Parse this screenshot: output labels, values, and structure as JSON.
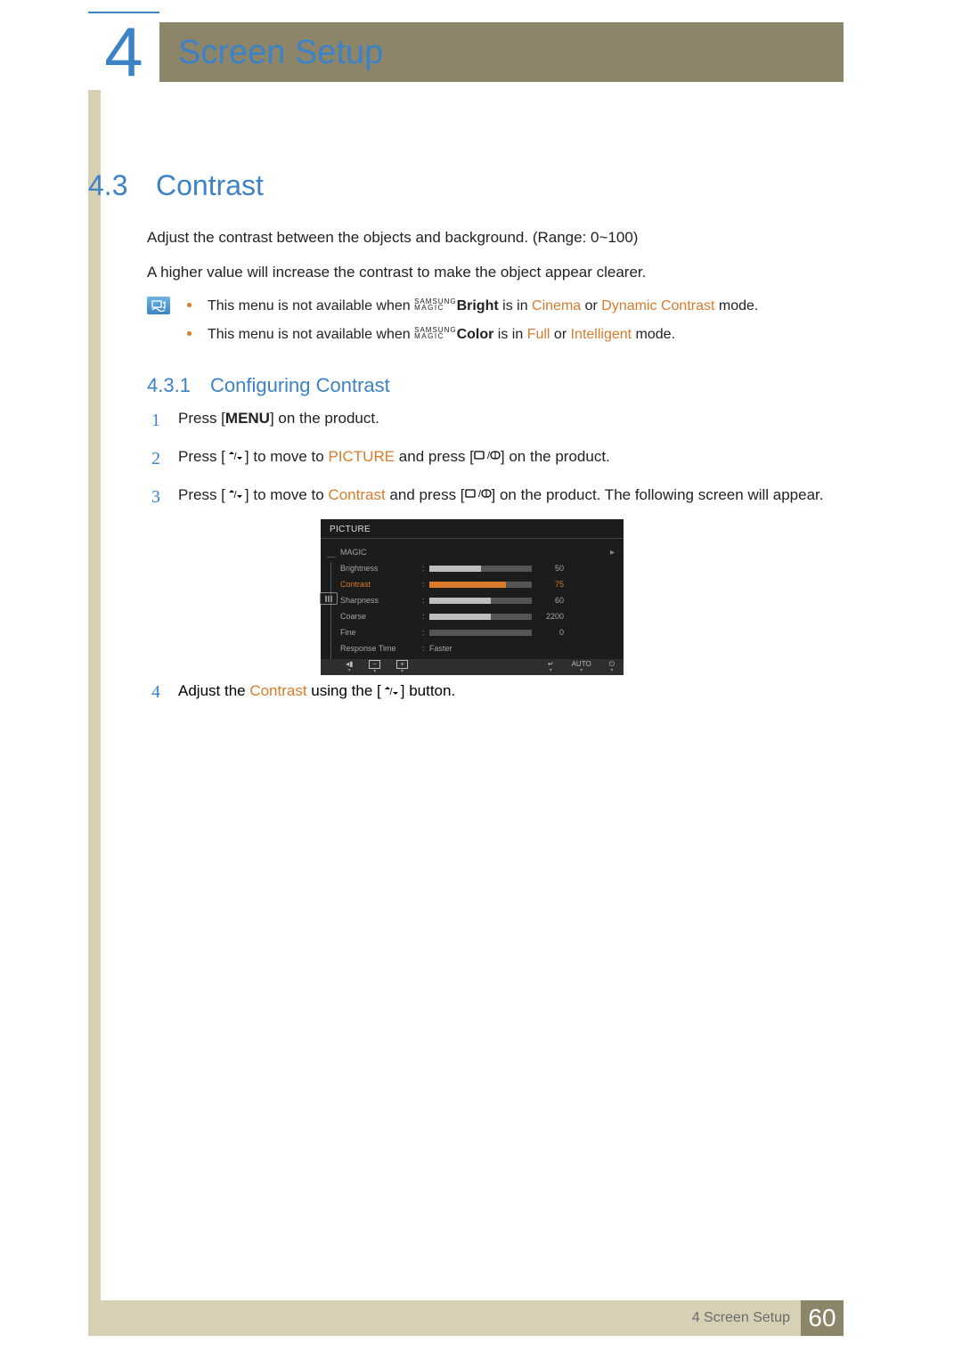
{
  "chapter": {
    "number": "4",
    "title": "Screen Setup"
  },
  "section": {
    "number": "4.3",
    "title": "Contrast"
  },
  "intro": {
    "p1": "Adjust the contrast between the objects and background. (Range: 0~100)",
    "p2": "A higher value will increase the contrast to make the object appear clearer."
  },
  "notes": {
    "n1_pre": "This menu is not available when ",
    "magic_top": "SAMSUNG",
    "magic_bot": "MAGIC",
    "n1_label": "Bright",
    "n1_mid": " is in ",
    "n1_hl1": "Cinema",
    "n1_or": " or ",
    "n1_hl2": "Dynamic Contrast",
    "n1_end": " mode.",
    "n2_pre": "This menu is not available when ",
    "n2_label": "Color",
    "n2_mid": " is in ",
    "n2_hl1": "Full",
    "n2_or": " or ",
    "n2_hl2": "Intelligent",
    "n2_end": " mode."
  },
  "subsection": {
    "number": "4.3.1",
    "title": "Configuring Contrast"
  },
  "steps": {
    "s1_num": "1",
    "s1_a": "Press [",
    "s1_menu": "MENU",
    "s1_b": "] on the product.",
    "s2_num": "2",
    "s2_a": "Press [",
    "s2_b": "] to move to ",
    "s2_pic": "PICTURE",
    "s2_c": " and press [",
    "s2_d": "] on the product.",
    "s3_num": "3",
    "s3_a": "Press [",
    "s3_b": "] to move to ",
    "s3_con": "Contrast",
    "s3_c": " and press [",
    "s3_d": "] on the product. The following screen will appear.",
    "s4_num": "4",
    "s4_a": "Adjust the ",
    "s4_con": "Contrast",
    "s4_b": " using the [",
    "s4_c": "] button."
  },
  "osd": {
    "title": "PICTURE",
    "rows": [
      {
        "label": "MAGIC",
        "type": "arrow"
      },
      {
        "label": "Brightness",
        "bar": 50,
        "max": 100,
        "val": "50"
      },
      {
        "label": "Contrast",
        "bar": 75,
        "max": 100,
        "val": "75",
        "sel": true
      },
      {
        "label": "Sharpness",
        "bar": 60,
        "max": 100,
        "val": "60"
      },
      {
        "label": "Coarse",
        "bar": 60,
        "max": 100,
        "val": "2200"
      },
      {
        "label": "Fine",
        "bar": 0,
        "max": 100,
        "val": "0"
      },
      {
        "label": "Response Time",
        "text": "Faster"
      }
    ],
    "footer": {
      "auto": "AUTO"
    }
  },
  "footer": {
    "text": "4 Screen Setup",
    "page": "60"
  },
  "icons": {
    "updown": "▲/▼"
  }
}
